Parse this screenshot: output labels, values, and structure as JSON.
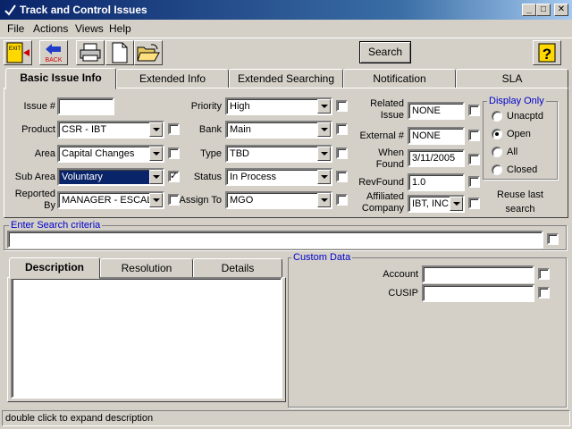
{
  "window": {
    "title": "Track and Control Issues",
    "min": "_",
    "max": "□",
    "close": "✕"
  },
  "menu": [
    "File",
    "Actions",
    "Views",
    "Help"
  ],
  "toolbar": {
    "exit_text": "EXIT",
    "back_text": "BACK",
    "search_label": "Search",
    "help_glyph": "?"
  },
  "tabs": [
    "Basic Issue Info",
    "Extended Info",
    "Extended Searching",
    "Notification",
    "SLA"
  ],
  "form": {
    "issue_label": "Issue #",
    "issue_value": "",
    "product_label": "Product",
    "product_value": "CSR - IBT",
    "area_label": "Area",
    "area_value": "Capital Changes",
    "subarea_label": "Sub Area",
    "subarea_value": "Voluntary",
    "reported_label": "Reported By",
    "reported_value": "MANAGER - ESCAL/",
    "priority_label": "Priority",
    "priority_value": "High",
    "bank_label": "Bank",
    "bank_value": "Main",
    "type_label": "Type",
    "type_value": "TBD",
    "status_label": "Status",
    "status_value": "In Process",
    "assign_label": "Assign To",
    "assign_value": "MGO",
    "related_label": "Related Issue",
    "related_value": "NONE",
    "external_label": "External #",
    "external_value": "NONE",
    "whenfound_label": "When Found",
    "whenfound_value": "3/11/2005",
    "revfound_label": "RevFound",
    "revfound_value": "1.0",
    "affiliated_label": "Affiliated Company",
    "affiliated_value": "IBT, INC"
  },
  "display_only": {
    "title": "Display Only",
    "options": [
      "Unacptd",
      "Open",
      "All",
      "Closed"
    ],
    "selected": "Open",
    "reuse_text": "Reuse last search"
  },
  "search_criteria": {
    "title": "Enter Search criteria",
    "value": ""
  },
  "bottom_tabs": [
    "Description",
    "Resolution",
    "Details"
  ],
  "custom_data": {
    "title": "Custom Data",
    "account_label": "Account",
    "cusip_label": "CUSIP"
  },
  "status_bar": "double click to expand description"
}
